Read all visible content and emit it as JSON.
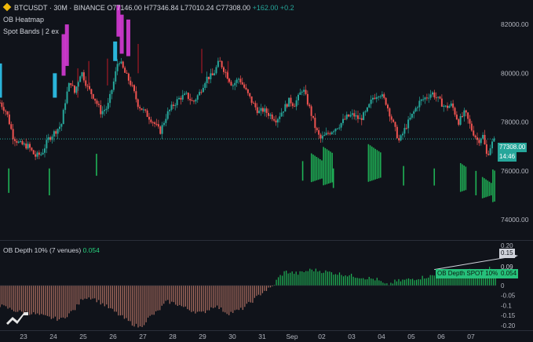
{
  "header": {
    "symbol": "BTCUSDT · 30M · BINANCE",
    "ohlc": "O77146.00 H77346.84 L77010.24 C77308.00",
    "change": "+162.00 +0.2",
    "line2": "OB Heatmap",
    "line3": "Spot Bands | 2 ex"
  },
  "indicator": {
    "label": "OB Depth 10% (7 venues)",
    "value": "0.054"
  },
  "price_tags": {
    "last": "77308.00",
    "countdown": "14:46"
  },
  "depth_tags": {
    "t1": "0.15",
    "t2": "0.09",
    "t3": "0.054",
    "spot_label": "OB Depth SPOT 10%"
  },
  "colors": {
    "up": "#26a69a",
    "down": "#ef5350",
    "green": "#21c55d",
    "magenta": "#d63bd6",
    "cyan": "#2ec7ef",
    "dark_red": "#8b1a24",
    "salmon": "#c07a6a"
  },
  "chart_data": [
    {
      "type": "candlestick",
      "yticks": [
        74000,
        76000,
        78000,
        80000,
        82000
      ],
      "ytick_labels": [
        "74000.00",
        "76000.00",
        "78000.00",
        "80000.00",
        "82000.00"
      ],
      "ylim": [
        73200,
        83000
      ],
      "xticks": [
        "23",
        "24",
        "25",
        "26",
        "27",
        "28",
        "29",
        "30",
        "31",
        "Sep",
        "02",
        "03",
        "04",
        "05",
        "06",
        "07"
      ],
      "last_price": 77308,
      "price_path": [
        [
          0.0,
          78800
        ],
        [
          0.3,
          78400
        ],
        [
          0.6,
          77400
        ],
        [
          0.9,
          77100
        ],
        [
          1.3,
          77000
        ],
        [
          1.6,
          76600
        ],
        [
          1.9,
          76700
        ],
        [
          2.2,
          77300
        ],
        [
          2.5,
          77600
        ],
        [
          2.8,
          77900
        ],
        [
          3.0,
          79000
        ],
        [
          3.2,
          79700
        ],
        [
          3.4,
          79200
        ],
        [
          3.7,
          80100
        ],
        [
          4.0,
          79400
        ],
        [
          4.3,
          79000
        ],
        [
          4.6,
          78400
        ],
        [
          4.9,
          78600
        ],
        [
          5.2,
          79700
        ],
        [
          5.4,
          80600
        ],
        [
          5.7,
          80000
        ],
        [
          6.0,
          79500
        ],
        [
          6.3,
          78700
        ],
        [
          6.7,
          78300
        ],
        [
          7.0,
          78000
        ],
        [
          7.3,
          77600
        ],
        [
          7.6,
          78300
        ],
        [
          7.9,
          78700
        ],
        [
          8.2,
          79000
        ],
        [
          8.5,
          79100
        ],
        [
          8.8,
          78800
        ],
        [
          9.1,
          79200
        ],
        [
          9.4,
          79800
        ],
        [
          9.7,
          79900
        ],
        [
          10.0,
          80500
        ],
        [
          10.3,
          80000
        ],
        [
          10.6,
          79500
        ],
        [
          10.9,
          79800
        ],
        [
          11.2,
          79300
        ],
        [
          11.5,
          78800
        ],
        [
          11.8,
          78400
        ],
        [
          12.0,
          78500
        ],
        [
          12.3,
          78300
        ],
        [
          12.6,
          78100
        ],
        [
          12.9,
          78500
        ],
        [
          13.2,
          78900
        ],
        [
          13.4,
          78700
        ],
        [
          13.6,
          79000
        ],
        [
          13.8,
          79400
        ],
        [
          14.1,
          78600
        ],
        [
          14.4,
          77700
        ],
        [
          14.6,
          77300
        ],
        [
          14.9,
          77500
        ],
        [
          15.2,
          77700
        ],
        [
          15.5,
          77900
        ],
        [
          15.8,
          78200
        ],
        [
          16.1,
          78300
        ],
        [
          16.4,
          78100
        ],
        [
          16.7,
          78400
        ],
        [
          17.0,
          79000
        ],
        [
          17.3,
          79200
        ],
        [
          17.6,
          78800
        ],
        [
          17.9,
          78000
        ],
        [
          18.2,
          77200
        ],
        [
          18.5,
          77800
        ],
        [
          18.8,
          78300
        ],
        [
          19.1,
          78800
        ],
        [
          19.4,
          79000
        ],
        [
          19.7,
          79200
        ],
        [
          20.0,
          78900
        ],
        [
          20.3,
          78600
        ],
        [
          20.6,
          78700
        ],
        [
          20.9,
          78000
        ],
        [
          21.2,
          78400
        ],
        [
          21.5,
          77700
        ],
        [
          21.8,
          77200
        ],
        [
          22.0,
          77500
        ],
        [
          22.2,
          76600
        ],
        [
          22.4,
          77100
        ],
        [
          22.6,
          77300
        ]
      ],
      "bands": [
        {
          "color": "magenta",
          "x": 2.9,
          "top": 81600,
          "bottom": 79900
        },
        {
          "color": "magenta",
          "x": 3.05,
          "top": 82000,
          "bottom": 80300
        },
        {
          "color": "cyan",
          "x": 2.5,
          "top": 80000,
          "bottom": 79000
        },
        {
          "color": "magenta",
          "x": 5.4,
          "top": 82800,
          "bottom": 81500
        },
        {
          "color": "magenta",
          "x": 5.55,
          "top": 82400,
          "bottom": 80800
        },
        {
          "color": "cyan",
          "x": 5.25,
          "top": 81300,
          "bottom": 80500
        },
        {
          "color": "magenta",
          "x": 5.85,
          "top": 82200,
          "bottom": 80700
        },
        {
          "color": "cyan",
          "x": 0.0,
          "top": 80400,
          "bottom": 79000
        },
        {
          "color": "dark_red",
          "x": 3.55,
          "top": 80200,
          "bottom": 79000
        },
        {
          "color": "dark_red",
          "x": 4.05,
          "top": 80500,
          "bottom": 79500
        },
        {
          "color": "dark_red",
          "x": 4.9,
          "top": 80600,
          "bottom": 79500
        },
        {
          "color": "dark_red",
          "x": 6.3,
          "top": 81200,
          "bottom": 80000
        },
        {
          "color": "dark_red",
          "x": 9.2,
          "top": 81000,
          "bottom": 80000
        },
        {
          "color": "dark_red",
          "x": 10.4,
          "top": 80500,
          "bottom": 79600
        },
        {
          "color": "green",
          "x": 0.4,
          "top": 76100,
          "bottom": 75100
        },
        {
          "color": "green",
          "x": 2.25,
          "top": 76100,
          "bottom": 75000
        },
        {
          "color": "green",
          "x": 4.4,
          "top": 76700,
          "bottom": 75800
        },
        {
          "color": "green",
          "x": 13.8,
          "top": 76400,
          "bottom": 75600
        },
        {
          "color": "green",
          "x": 15.2,
          "top": 76100,
          "bottom": 75300
        },
        {
          "color": "green",
          "x": 18.4,
          "top": 76200,
          "bottom": 75400
        },
        {
          "color": "green",
          "x": 19.8,
          "top": 76100,
          "bottom": 75400
        },
        {
          "color": "green",
          "x": 21.7,
          "top": 76000,
          "bottom": 75000
        }
      ],
      "green_clusters": [
        {
          "x0": 14.2,
          "x1": 15.2,
          "top": 77000,
          "bottom": 75400
        },
        {
          "x0": 16.8,
          "x1": 17.4,
          "top": 77200,
          "bottom": 75500
        },
        {
          "x0": 21.0,
          "x1": 21.3,
          "top": 76600,
          "bottom": 75000
        },
        {
          "x0": 22.0,
          "x1": 22.6,
          "top": 76100,
          "bottom": 74700
        }
      ]
    },
    {
      "type": "bar",
      "label": "OB Depth 10% (7 venues)",
      "yticks": [
        -0.2,
        -0.15,
        -0.1,
        -0.05,
        0,
        0.05,
        0.1,
        0.15,
        0.2
      ],
      "ytick_labels": [
        "-0.20",
        "-0.15",
        "-0.1",
        "-0.05",
        "0",
        "0.05",
        "",
        "",
        "0.20"
      ],
      "ylim": [
        -0.22,
        0.22
      ],
      "last_value": 0.054,
      "depth_path": [
        [
          0.0,
          -0.1
        ],
        [
          0.8,
          -0.13
        ],
        [
          1.5,
          -0.14
        ],
        [
          2.2,
          -0.16
        ],
        [
          2.8,
          -0.17
        ],
        [
          3.4,
          -0.12
        ],
        [
          3.8,
          -0.06
        ],
        [
          4.2,
          -0.06
        ],
        [
          4.8,
          -0.1
        ],
        [
          5.2,
          -0.13
        ],
        [
          5.6,
          -0.16
        ],
        [
          6.0,
          -0.19
        ],
        [
          6.4,
          -0.21
        ],
        [
          6.8,
          -0.16
        ],
        [
          7.2,
          -0.13
        ],
        [
          7.6,
          -0.08
        ],
        [
          8.0,
          -0.09
        ],
        [
          8.6,
          -0.12
        ],
        [
          9.2,
          -0.14
        ],
        [
          9.8,
          -0.1
        ],
        [
          10.4,
          -0.14
        ],
        [
          11.0,
          -0.12
        ],
        [
          11.6,
          -0.07
        ],
        [
          12.0,
          -0.03
        ],
        [
          12.4,
          -0.01
        ],
        [
          12.7,
          0.04
        ],
        [
          13.0,
          0.07
        ],
        [
          13.6,
          0.06
        ],
        [
          14.2,
          0.08
        ],
        [
          14.8,
          0.07
        ],
        [
          15.4,
          0.06
        ],
        [
          16.0,
          0.05
        ],
        [
          16.6,
          0.04
        ],
        [
          17.2,
          0.03
        ],
        [
          17.6,
          0.0
        ],
        [
          18.0,
          0.02
        ],
        [
          18.6,
          0.03
        ],
        [
          19.2,
          0.04
        ],
        [
          19.8,
          0.05
        ],
        [
          20.4,
          0.07
        ],
        [
          21.0,
          0.06
        ],
        [
          21.6,
          0.08
        ],
        [
          22.0,
          0.07
        ],
        [
          22.4,
          0.09
        ],
        [
          22.6,
          0.054
        ]
      ],
      "arrow": {
        "from": [
          19.8,
          0.08
        ],
        "to": [
          23.6,
          0.15
        ]
      }
    }
  ]
}
